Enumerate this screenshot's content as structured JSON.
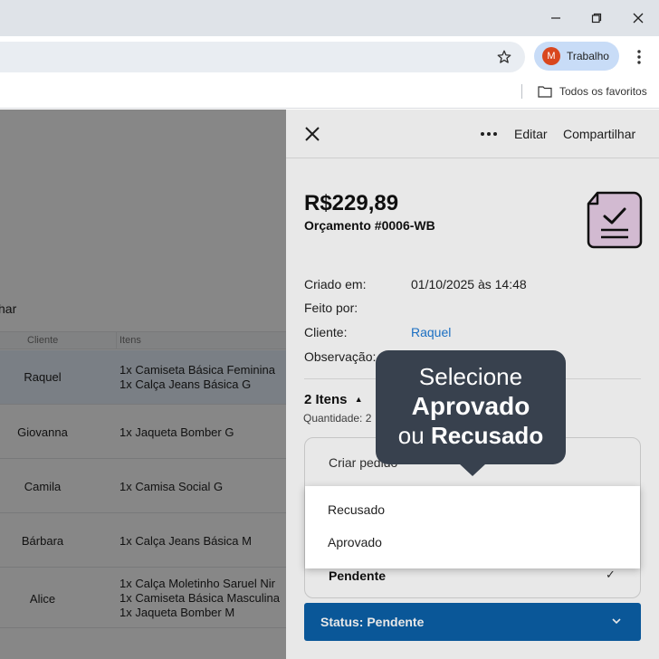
{
  "browser": {
    "profile_initial": "M",
    "profile_name": "Trabalho",
    "bookmark_folder": "Todos os favoritos"
  },
  "background_page": {
    "partial_label": "har",
    "columns": [
      "Cliente",
      "Itens"
    ],
    "rows": [
      {
        "cliente": "Raquel",
        "itens": [
          "1x Camiseta Básica Feminina",
          "1x Calça Jeans Básica G"
        ]
      },
      {
        "cliente": "Giovanna",
        "itens": [
          "1x Jaqueta Bomber G"
        ]
      },
      {
        "cliente": "Camila",
        "itens": [
          "1x Camisa Social G"
        ]
      },
      {
        "cliente": "Bárbara",
        "itens": [
          "1x Calça Jeans Básica M"
        ]
      },
      {
        "cliente": "Alice",
        "itens": [
          "1x Calça Moletinho Saruel Nir",
          "1x Camiseta Básica Masculina",
          "1x Jaqueta Bomber M"
        ]
      }
    ]
  },
  "panel": {
    "more_icon": "more-horizontal-icon",
    "edit_label": "Editar",
    "share_label": "Compartilhar",
    "amount": "R$229,89",
    "quote_number": "Orçamento #0006-WB",
    "info": {
      "created_label": "Criado em:",
      "created_value": "01/10/2025 às 14:48",
      "made_by_label": "Feito por:",
      "client_label": "Cliente:",
      "client_value": "Raquel",
      "notes_label": "Observação:"
    },
    "items_title": "2 Itens",
    "quantity": "Quantidade: 2",
    "create_order": "Criar pedido",
    "pending_option": "Pendente",
    "status_button": "Status: Pendente"
  },
  "dropdown": {
    "options": [
      "Recusado",
      "Aprovado"
    ]
  },
  "callout": {
    "line1": "Selecione",
    "line2": "Aprovado",
    "line3_prefix": "ou",
    "line3_bold": "Recusado"
  },
  "colors": {
    "accent_blue": "#0b60a8",
    "link_blue": "#1e7ad6",
    "callout_bg": "#38414e",
    "doc_icon_fill": "#e7cde6",
    "avatar": "#d9471f"
  }
}
